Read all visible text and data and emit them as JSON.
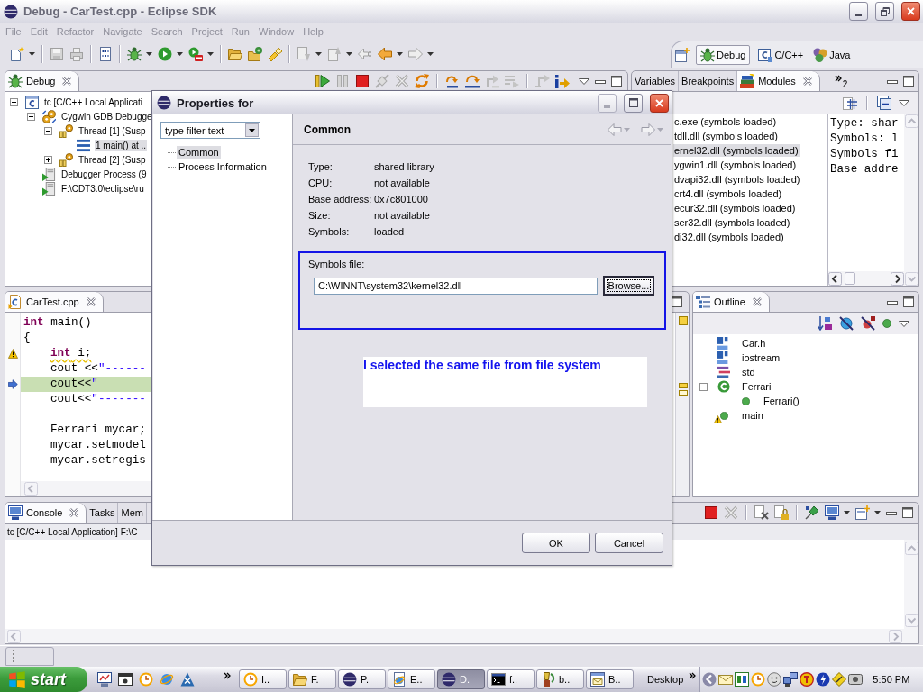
{
  "window": {
    "title": "Debug - CarTest.cpp - Eclipse SDK"
  },
  "menu": [
    {
      "label": "File",
      "disabled": true
    },
    {
      "label": "Edit",
      "disabled": true
    },
    {
      "label": "Refactor",
      "disabled": true
    },
    {
      "label": "Navigate",
      "disabled": true
    },
    {
      "label": "Search",
      "disabled": true
    },
    {
      "label": "Project",
      "disabled": true
    },
    {
      "label": "Run",
      "disabled": true
    },
    {
      "label": "Window",
      "disabled": true
    },
    {
      "label": "Help",
      "disabled": true
    }
  ],
  "perspectives": [
    {
      "label": "Debug",
      "kind": "debug",
      "selected": true
    },
    {
      "label": "C/C++",
      "kind": "cpp",
      "selected": false
    },
    {
      "label": "Java",
      "kind": "java",
      "selected": false
    }
  ],
  "debug_view": {
    "tabs": [
      {
        "label": "Debug",
        "selected": true
      }
    ],
    "tree": [
      {
        "label": "tc [C/C++ Local Applicati",
        "kind": "launch",
        "expanded": true,
        "selected": false,
        "children": [
          {
            "label": "Cygwin GDB Debugge",
            "kind": "debugger",
            "expanded": true,
            "selected": false,
            "children": [
              {
                "label": "Thread [1] (Susp",
                "kind": "thread",
                "expanded": true,
                "selected": false,
                "children": [
                  {
                    "label": "1 main() at ..",
                    "kind": "frame",
                    "selected": true
                  }
                ]
              },
              {
                "label": "Thread [2] (Susp",
                "kind": "thread",
                "expanded": false,
                "selected": false
              }
            ]
          },
          {
            "label": "Debugger Process (9",
            "kind": "process",
            "selected": false
          },
          {
            "label": "F:\\CDT3.0\\eclipse\\ru",
            "kind": "process",
            "selected": false
          }
        ]
      }
    ]
  },
  "modules_view": {
    "tabs": [
      {
        "label": "Variables",
        "selected": false
      },
      {
        "label": "Breakpoints",
        "selected": false
      },
      {
        "label": "Modules",
        "selected": true
      }
    ],
    "overflow_count": "2",
    "modules": [
      {
        "label": "c.exe (symbols loaded)",
        "selected": false
      },
      {
        "label": "tdll.dll (symbols loaded)",
        "selected": false
      },
      {
        "label": "ernel32.dll (symbols loaded)",
        "selected": true
      },
      {
        "label": "ygwin1.dll (symbols loaded)",
        "selected": false
      },
      {
        "label": "dvapi32.dll (symbols loaded)",
        "selected": false
      },
      {
        "label": "crt4.dll (symbols loaded)",
        "selected": false
      },
      {
        "label": "ecur32.dll (symbols loaded)",
        "selected": false
      },
      {
        "label": "ser32.dll (symbols loaded)",
        "selected": false
      },
      {
        "label": "di32.dll (symbols loaded)",
        "selected": false
      }
    ],
    "details": [
      "Type: shar",
      "Symbols: l",
      "Symbols fi",
      "Base addre"
    ]
  },
  "editor": {
    "tabs": [
      {
        "label": "CarTest.cpp",
        "selected": true
      }
    ],
    "lines": [
      {
        "kind": "code",
        "tokens": [
          {
            "text": "int",
            "kind": "keyword"
          },
          {
            "text": " main()",
            "kind": "plain"
          }
        ],
        "indented": false,
        "warning": false,
        "current": false
      },
      {
        "kind": "code",
        "tokens": [
          {
            "text": "{",
            "kind": "plain"
          }
        ],
        "indented": false,
        "warning": false,
        "current": false
      },
      {
        "kind": "code",
        "tokens": [
          {
            "text": "int",
            "kind": "keyword"
          },
          {
            "text": " i;",
            "kind": "plain"
          }
        ],
        "indented": true,
        "warning": true,
        "current": false
      },
      {
        "kind": "code",
        "tokens": [
          {
            "text": "cout <<",
            "kind": "plain"
          },
          {
            "text": "\"------",
            "kind": "string"
          }
        ],
        "indented": true,
        "warning": false,
        "current": false
      },
      {
        "kind": "code",
        "tokens": [
          {
            "text": "cout<<",
            "kind": "plain"
          },
          {
            "text": "\"",
            "kind": "string"
          }
        ],
        "indented": true,
        "warning": false,
        "current": true
      },
      {
        "kind": "code",
        "tokens": [
          {
            "text": "cout<<",
            "kind": "plain"
          },
          {
            "text": "\"-------",
            "kind": "string"
          }
        ],
        "indented": true,
        "warning": false,
        "current": false
      },
      {
        "kind": "blank"
      },
      {
        "kind": "code",
        "tokens": [
          {
            "text": "Ferrari mycar;",
            "kind": "plain"
          }
        ],
        "indented": true,
        "warning": false,
        "current": false
      },
      {
        "kind": "code",
        "tokens": [
          {
            "text": "mycar.setmodel",
            "kind": "plain"
          }
        ],
        "indented": true,
        "warning": false,
        "current": false
      },
      {
        "kind": "code",
        "tokens": [
          {
            "text": "mycar.setregis",
            "kind": "plain"
          }
        ],
        "indented": true,
        "warning": false,
        "current": false
      }
    ]
  },
  "outline": {
    "tabs": [
      {
        "label": "Outline",
        "selected": true
      }
    ],
    "tree": [
      {
        "label": "Car.h",
        "kind": "include",
        "warning": false,
        "selected": false
      },
      {
        "label": "iostream",
        "kind": "include",
        "warning": false,
        "selected": false
      },
      {
        "label": "std",
        "kind": "namespace",
        "warning": false,
        "selected": false
      },
      {
        "label": "Ferrari",
        "kind": "class",
        "expanded": true,
        "warning": false,
        "selected": false,
        "children": [
          {
            "label": "Ferrari()",
            "kind": "method",
            "warning": false,
            "selected": false
          }
        ]
      },
      {
        "label": "main",
        "kind": "function",
        "warning": true,
        "selected": false
      }
    ]
  },
  "console": {
    "tabs": [
      {
        "label": "Console",
        "selected": true
      },
      {
        "label": "Tasks",
        "selected": false
      },
      {
        "label": "Mem",
        "selected": false
      }
    ],
    "process_label": "tc [C/C++ Local Application] F:\\C"
  },
  "dialog": {
    "title": "Properties for",
    "filter": {
      "value": "type filter text"
    },
    "pages": [
      {
        "label": "Common",
        "selected": true
      },
      {
        "label": "Process Information",
        "selected": false
      }
    ],
    "page_title": "Common",
    "properties": [
      {
        "label": "Type:",
        "value": "shared library"
      },
      {
        "label": "CPU:",
        "value": "not available"
      },
      {
        "label": "Base address:",
        "value": "0x7c801000"
      },
      {
        "label": "Size:",
        "value": "not available"
      },
      {
        "label": "Symbols:",
        "value": "loaded"
      }
    ],
    "symbols_file": {
      "label": "Symbols file:",
      "value": "C:\\WINNT\\system32\\kernel32.dll",
      "button": "Browse..."
    },
    "buttons": [
      {
        "label": "OK"
      },
      {
        "label": "Cancel"
      }
    ]
  },
  "annotation": {
    "text": "I selected the same file from file system"
  },
  "taskbar": {
    "start": "start",
    "tasks": [
      {
        "label": "I..",
        "kind": "clock",
        "selected": false
      },
      {
        "label": "F.",
        "kind": "folder",
        "selected": false
      },
      {
        "label": "P.",
        "kind": "eclipse",
        "selected": false
      },
      {
        "label": "E..",
        "kind": "browser",
        "selected": false
      },
      {
        "label": "D.",
        "kind": "eclipse",
        "selected": true
      },
      {
        "label": "f..",
        "kind": "console",
        "selected": false
      },
      {
        "label": "b..",
        "kind": "paint",
        "selected": false
      },
      {
        "label": "B..",
        "kind": "mail",
        "selected": false
      }
    ],
    "toolbar_label": "Desktop",
    "clock": "5:50 PM"
  }
}
